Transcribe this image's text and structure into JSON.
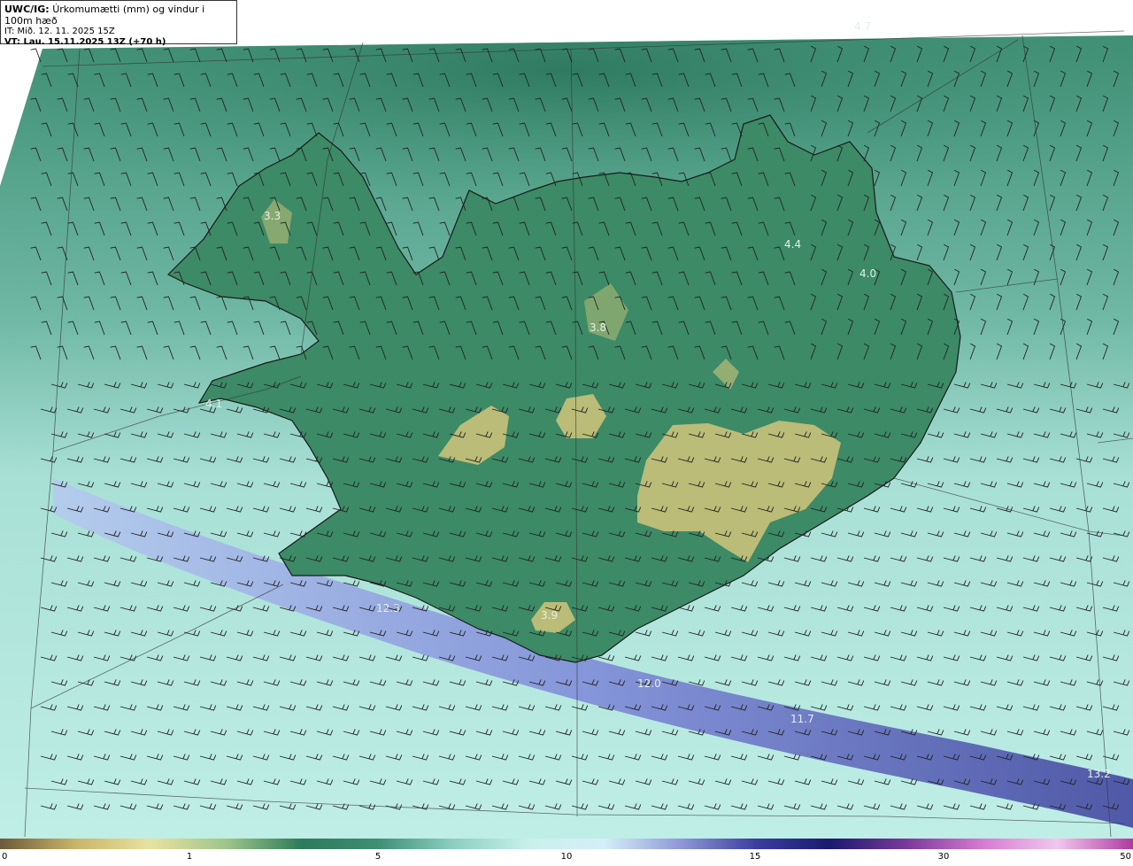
{
  "header": {
    "product": "UWC/IG:",
    "description": "Úrkomumætti (mm) og vindur i 100m hæð",
    "init_time": "IT: Mið. 12. 11. 2025 15Z",
    "valid_time": "VT: Lau. 15.11.2025 13Z (+70 h)"
  },
  "map_labels": [
    {
      "id": "max-north-east-sea",
      "value": "4.7"
    },
    {
      "id": "max-westfjords",
      "value": "3.3"
    },
    {
      "id": "max-north-east",
      "value": "4.4"
    },
    {
      "id": "max-east",
      "value": "4.0"
    },
    {
      "id": "max-north-central",
      "value": "3.8"
    },
    {
      "id": "max-snaefellsnes",
      "value": "4.1"
    },
    {
      "id": "max-south",
      "value": "3.9"
    },
    {
      "id": "max-south-sea-west",
      "value": "12.3"
    },
    {
      "id": "max-south-sea-central",
      "value": "12.0"
    },
    {
      "id": "max-south-sea-east",
      "value": "11.7"
    },
    {
      "id": "max-south-sea-far-east",
      "value": "13.2"
    }
  ],
  "colorbar": {
    "ticks": [
      "0",
      "1",
      "5",
      "10",
      "15",
      "30",
      "50"
    ],
    "colors": [
      "#6b5a3a",
      "#c9b56a",
      "#e8e2a0",
      "#9fc48a",
      "#2e7a5a",
      "#3f8f74",
      "#8ccfc0",
      "#c8f0ea",
      "#d6eefa",
      "#8f9ad8",
      "#3a3f9e",
      "#1a1a6e",
      "#7a3a9a",
      "#d67ad0",
      "#f2c7ee",
      "#b03aa0"
    ]
  }
}
